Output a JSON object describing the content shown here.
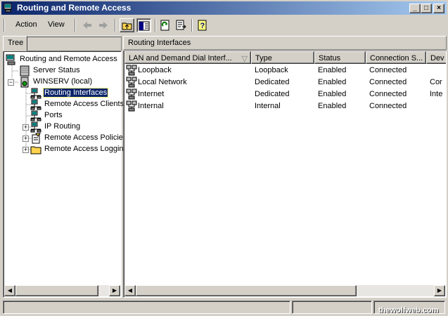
{
  "window": {
    "title": "Routing and Remote Access"
  },
  "menu": {
    "action": "Action",
    "view": "View"
  },
  "left": {
    "tab_label": "Tree"
  },
  "tree": [
    {
      "label": "Routing and Remote Access",
      "icon": "server-tree-icon"
    },
    {
      "label": "Server Status",
      "icon": "server-status-icon"
    },
    {
      "label": "WINSERV (local)",
      "icon": "server-icon"
    },
    {
      "label": "Routing Interfaces",
      "icon": "network-interfaces-icon"
    },
    {
      "label": "Remote Access Clients",
      "icon": "clients-icon"
    },
    {
      "label": "Ports",
      "icon": "ports-icon"
    },
    {
      "label": "IP Routing",
      "icon": "ip-routing-icon"
    },
    {
      "label": "Remote Access Policies",
      "icon": "policy-icon"
    },
    {
      "label": "Remote Access Logging",
      "icon": "folder-icon"
    }
  ],
  "right": {
    "header": "Routing Interfaces",
    "columns": [
      "LAN and Demand Dial Interf...",
      "Type",
      "Status",
      "Connection S...",
      "Dev"
    ],
    "rows": [
      [
        "Loopback",
        "Loopback",
        "Enabled",
        "Connected",
        ""
      ],
      [
        "Local Network",
        "Dedicated",
        "Enabled",
        "Connected",
        "Cor"
      ],
      [
        "Internet",
        "Dedicated",
        "Enabled",
        "Connected",
        "Inte"
      ],
      [
        "Internal",
        "Internal",
        "Enabled",
        "Connected",
        ""
      ]
    ]
  },
  "watermark": "thewolfweb.com",
  "colors": {
    "titlebar": "#0a246a",
    "selection": "#0a246a",
    "chrome": "#d4d0c8"
  }
}
